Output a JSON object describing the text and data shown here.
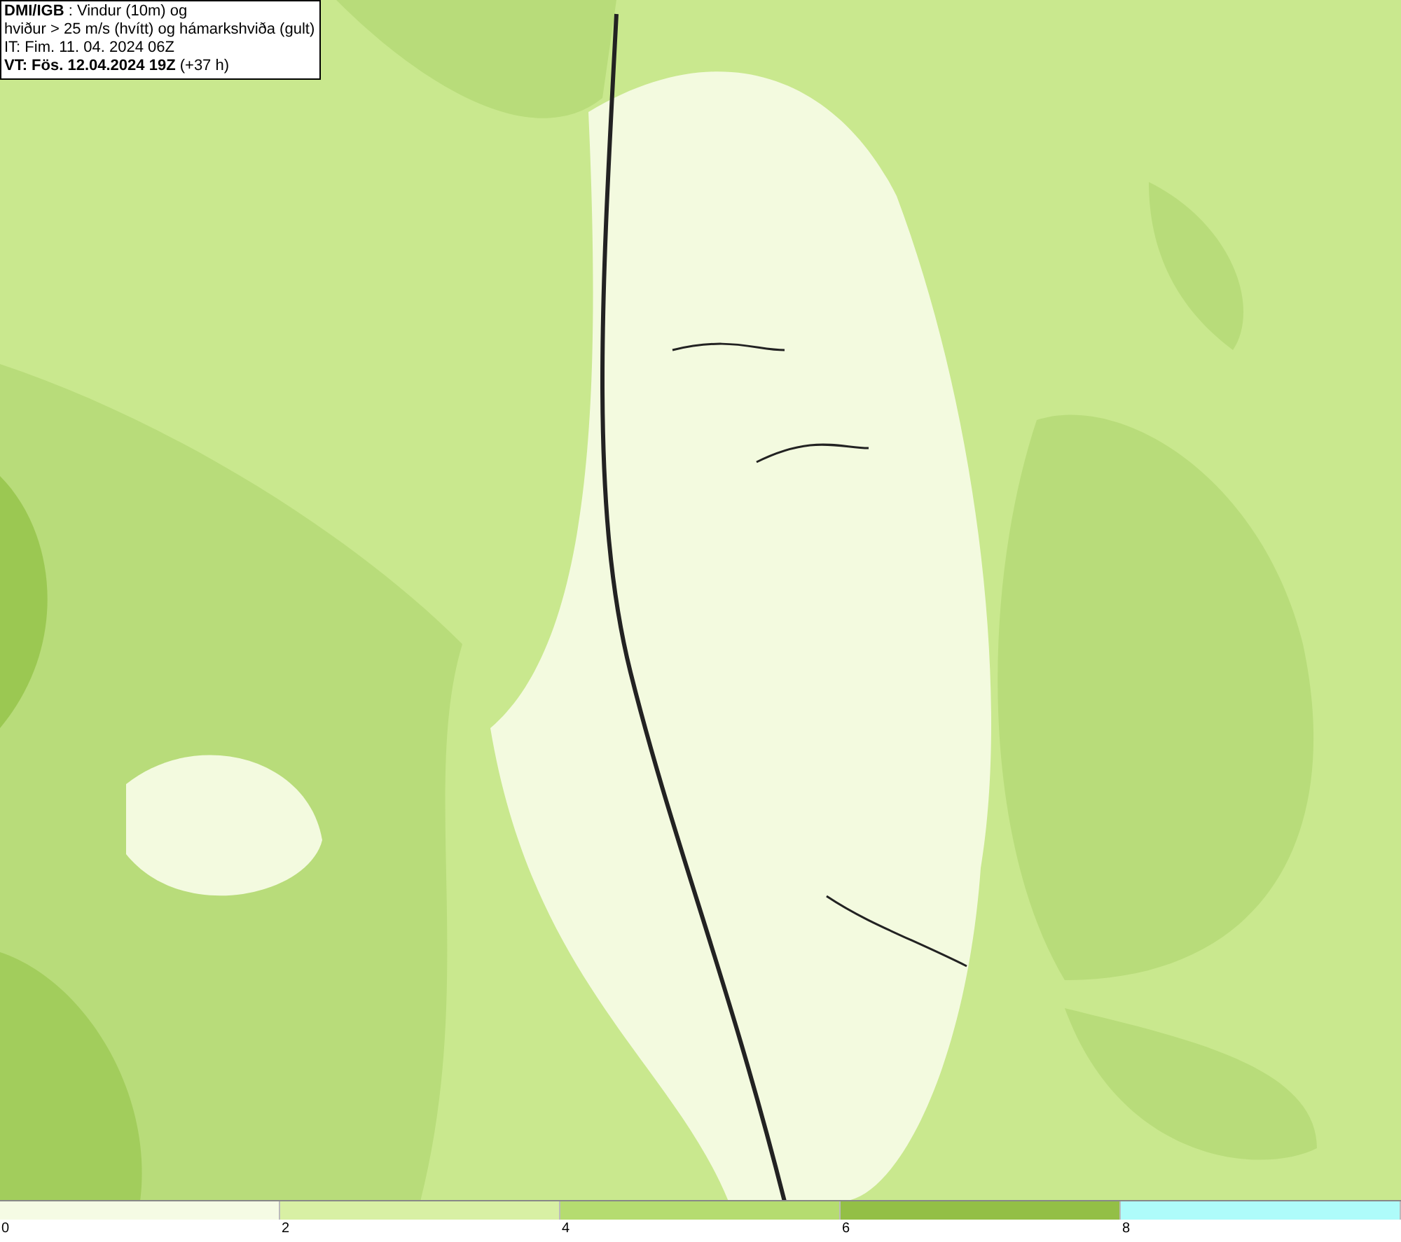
{
  "info_box": {
    "lines": [
      "**DMI/IGB** : Vindur (10m) og",
      "hviður > 25 m/s (hvítt) og hámarkshviða (gult)",
      "IT: Fim. 11. 04. 2024 06Z",
      "**VT: Fös. 12.04.2024 19Z** (+37 h)"
    ]
  },
  "legend": {
    "bins": [
      {
        "label": "0",
        "color": "#f5fbe4"
      },
      {
        "label": "2",
        "color": "#d8f0a4"
      },
      {
        "label": "4",
        "color": "#b5dc70"
      },
      {
        "label": "6",
        "color": "#93bf46"
      },
      {
        "label": "8",
        "color": "#aefcfa"
      }
    ]
  }
}
